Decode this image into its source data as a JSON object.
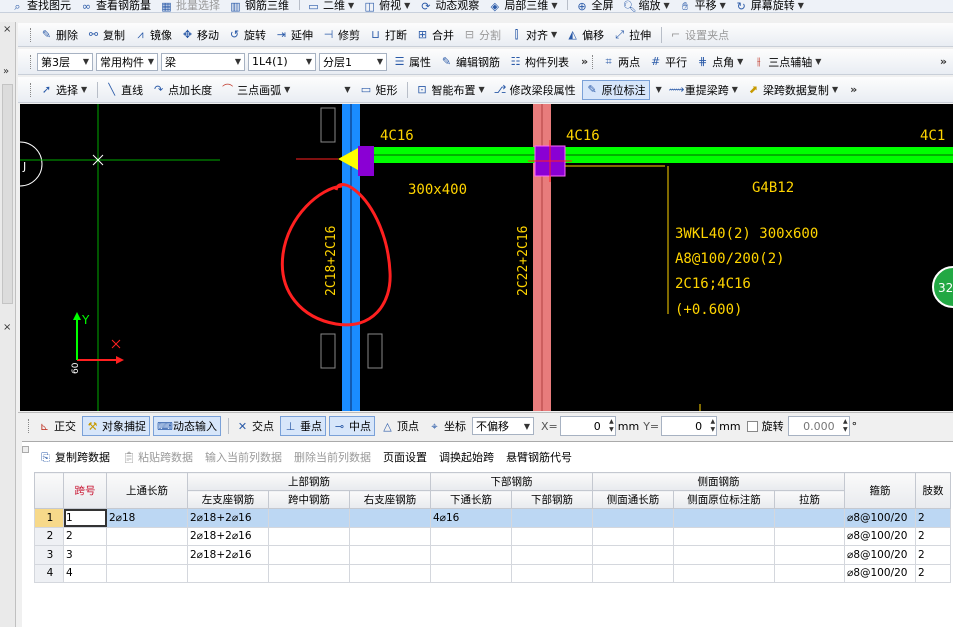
{
  "menu_top": {
    "items": [
      "查找图元",
      "查看钢筋量",
      "批量选择",
      "钢筋三维",
      "二维",
      "俯视",
      "动态观察",
      "局部三维",
      "全屏",
      "缩放",
      "平移",
      "屏幕旋转"
    ]
  },
  "edit_toolbar": {
    "items": [
      "删除",
      "复制",
      "镜像",
      "移动",
      "旋转",
      "延伸",
      "修剪",
      "打断",
      "合并",
      "分割",
      "对齐",
      "偏移",
      "拉伸",
      "设置夹点"
    ]
  },
  "layer_toolbar": {
    "floor": "第3层",
    "category": "常用构件",
    "type": "梁",
    "element": "1L4(1)",
    "sublayer": "分层1",
    "attr_label": "属性",
    "edit_rebar_label": "编辑钢筋",
    "component_list_label": "构件列表",
    "two_point_label": "两点",
    "parallel_label": "平行",
    "point_angle_label": "点角",
    "three_point_axis_label": "三点辅轴"
  },
  "draw_toolbar": {
    "items": [
      "选择",
      "直线",
      "点加长度",
      "三点画弧",
      "矩形",
      "智能布置",
      "修改梁段属性",
      "原位标注",
      "重提梁跨",
      "梁跨数据复制"
    ]
  },
  "cad": {
    "labels_top": [
      "4C16",
      "4C16",
      "4C1"
    ],
    "section_label": "300x400",
    "beam_name": "G4B12",
    "annotation_lines": [
      "3WKL40(2) 300x600",
      "A8@100/200(2)",
      "2C16;4C16",
      "(+0.600)"
    ],
    "vertical_labels": [
      "2C18+2C16",
      "2C22+2C16"
    ],
    "axis_y": "Y",
    "axis_small": "60",
    "badge": "32",
    "left_mark": "J"
  },
  "snap_toolbar": {
    "ortho_label": "正交",
    "snap_label": "对象捕捉",
    "dynamic_input_label": "动态输入",
    "intersect_label": "交点",
    "perp_label": "垂点",
    "mid_label": "中点",
    "vertex_label": "顶点",
    "coord_label": "坐标",
    "offset_mode": "不偏移",
    "x_label": "X=",
    "x_value": "0",
    "y_label": "Y=",
    "y_value": "0",
    "unit": "mm",
    "rotate_label": "旋转",
    "rotate_value": "0.000",
    "degree": "°"
  },
  "grid_toolbar": {
    "items": [
      "复制跨数据",
      "粘贴跨数据",
      "输入当前列数据",
      "删除当前列数据",
      "页面设置",
      "调换起始跨",
      "悬臂钢筋代号"
    ]
  },
  "table": {
    "group_headers": {
      "top": "上部钢筋",
      "bottom": "下部钢筋",
      "side": "侧面钢筋"
    },
    "headers": {
      "span_no": "跨号",
      "top_through": "上通长筋",
      "left_support": "左支座钢筋",
      "mid_span": "跨中钢筋",
      "right_support": "右支座钢筋",
      "bottom_through": "下通长筋",
      "bottom_rebar": "下部钢筋",
      "side_through": "侧面通长筋",
      "side_inplace": "侧面原位标注筋",
      "tie": "拉筋",
      "stirrup": "箍筋",
      "legs": "肢数"
    },
    "rows": [
      {
        "rn": "1",
        "span": "1",
        "top_through": "2⌀18",
        "left_support": "2⌀18+2⌀16",
        "mid_span": "",
        "right_support": "",
        "bottom_through": "4⌀16",
        "bottom_rebar": "",
        "side_through": "",
        "side_inplace": "",
        "tie": "",
        "stirrup": "⌀8@100/20",
        "legs": "2"
      },
      {
        "rn": "2",
        "span": "2",
        "top_through": "",
        "left_support": "2⌀18+2⌀16",
        "mid_span": "",
        "right_support": "",
        "bottom_through": "",
        "bottom_rebar": "",
        "side_through": "",
        "side_inplace": "",
        "tie": "",
        "stirrup": "⌀8@100/20",
        "legs": "2"
      },
      {
        "rn": "3",
        "span": "3",
        "top_through": "",
        "left_support": "2⌀18+2⌀16",
        "mid_span": "",
        "right_support": "",
        "bottom_through": "",
        "bottom_rebar": "",
        "side_through": "",
        "side_inplace": "",
        "tie": "",
        "stirrup": "⌀8@100/20",
        "legs": "2"
      },
      {
        "rn": "4",
        "span": "4",
        "top_through": "",
        "left_support": "",
        "mid_span": "",
        "right_support": "",
        "bottom_through": "",
        "bottom_rebar": "",
        "side_through": "",
        "side_inplace": "",
        "tie": "",
        "stirrup": "⌀8@100/20",
        "legs": "2"
      }
    ]
  },
  "colors": {
    "beam_green": "#00ff00",
    "column_blue": "#1a8cff",
    "column_pink": "#e87c7c",
    "node_purple": "#8a00d4",
    "cad_text": "#ffd400",
    "sketch_red": "#ff2020",
    "selected_row": "#bcd7f3"
  }
}
